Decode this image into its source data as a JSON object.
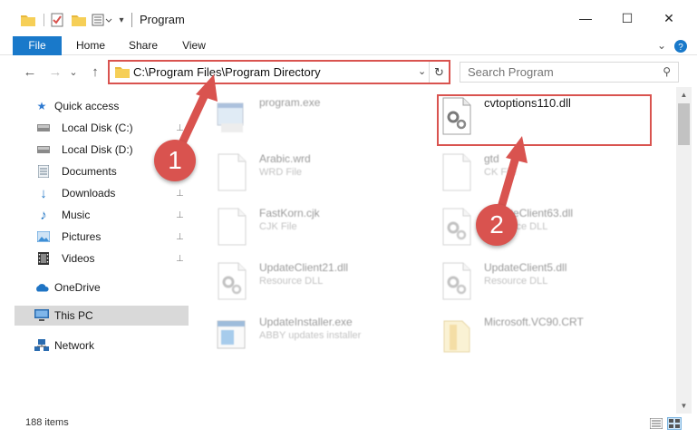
{
  "window": {
    "title": "Program",
    "minimize": "—",
    "maximize": "☐",
    "close": "✕"
  },
  "ribbon": {
    "tabs": [
      "File",
      "Home",
      "Share",
      "View"
    ],
    "expand": "⌄",
    "help": "?"
  },
  "nav": {
    "back": "←",
    "forward": "→",
    "recent": "⌄",
    "up": "↑"
  },
  "address": {
    "path": "C:\\Program Files\\Program Directory",
    "dropdown": "⌄",
    "refresh": "↻"
  },
  "search": {
    "placeholder": "Search Program",
    "icon": "⚲"
  },
  "sidebar": {
    "items": [
      {
        "label": "Quick access",
        "icon": "star-icon",
        "glyph": "★",
        "color": "#2e7ad1",
        "pinned": false
      },
      {
        "label": "Local Disk (C:)",
        "icon": "drive-icon",
        "glyph": "▬",
        "color": "#555555",
        "pinned": true
      },
      {
        "label": "Local Disk (D:)",
        "icon": "drive-icon",
        "glyph": "▬",
        "color": "#555555",
        "pinned": false
      },
      {
        "label": "Documents",
        "icon": "documents-icon",
        "glyph": "▤",
        "color": "#6a7d8e",
        "pinned": true
      },
      {
        "label": "Downloads",
        "icon": "downloads-icon",
        "glyph": "↓",
        "color": "#1f74c4",
        "pinned": true
      },
      {
        "label": "Music",
        "icon": "music-icon",
        "glyph": "♪",
        "color": "#1f74c4",
        "pinned": true
      },
      {
        "label": "Pictures",
        "icon": "pictures-icon",
        "glyph": "▦",
        "color": "#3d8fd6",
        "pinned": true
      },
      {
        "label": "Videos",
        "icon": "videos-icon",
        "glyph": "▥",
        "color": "#333333",
        "pinned": true
      },
      {
        "label": "OneDrive",
        "icon": "onedrive-icon",
        "glyph": "☁",
        "color": "#1f74c4",
        "pinned": false
      },
      {
        "label": "This PC",
        "icon": "this-pc-icon",
        "glyph": "▭",
        "color": "#2b6cb0",
        "pinned": false
      },
      {
        "label": "Network",
        "icon": "network-icon",
        "glyph": "⊞",
        "color": "#2b6cb0",
        "pinned": false
      }
    ],
    "pin_glyph": "📌"
  },
  "files": [
    {
      "name": "program.exe",
      "sub": "",
      "kind": "exe",
      "faded": true
    },
    {
      "name": "cvtoptions110.dll",
      "sub": "",
      "kind": "dll",
      "faded": false
    },
    {
      "name": "Arabic.wrd",
      "sub": "WRD File",
      "kind": "blank",
      "faded": true
    },
    {
      "name": "gtd",
      "sub": "CK File",
      "kind": "blank",
      "faded": true
    },
    {
      "name": "FastKorn.cjk",
      "sub": "CJK File",
      "kind": "blank",
      "faded": true
    },
    {
      "name": "UpdateClient63.dll",
      "sub": "Resource DLL",
      "kind": "dll",
      "faded": true
    },
    {
      "name": "UpdateClient21.dll",
      "sub": "Resource DLL",
      "kind": "dll",
      "faded": true
    },
    {
      "name": "UpdateClient5.dll",
      "sub": "Resource DLL",
      "kind": "dll",
      "faded": true
    },
    {
      "name": "UpdateInstaller.exe",
      "sub": "ABBY updates installer",
      "kind": "installer",
      "faded": true
    },
    {
      "name": "Microsoft.VC90.CRT",
      "sub": "",
      "kind": "folder",
      "faded": true
    }
  ],
  "status": {
    "count": "188 items"
  },
  "annotations": {
    "badge1": "1",
    "badge2": "2",
    "color": "#d9534f"
  },
  "colors": {
    "accent": "#1979ca",
    "highlight": "#d9534f",
    "selected": "#d9d9d9"
  }
}
